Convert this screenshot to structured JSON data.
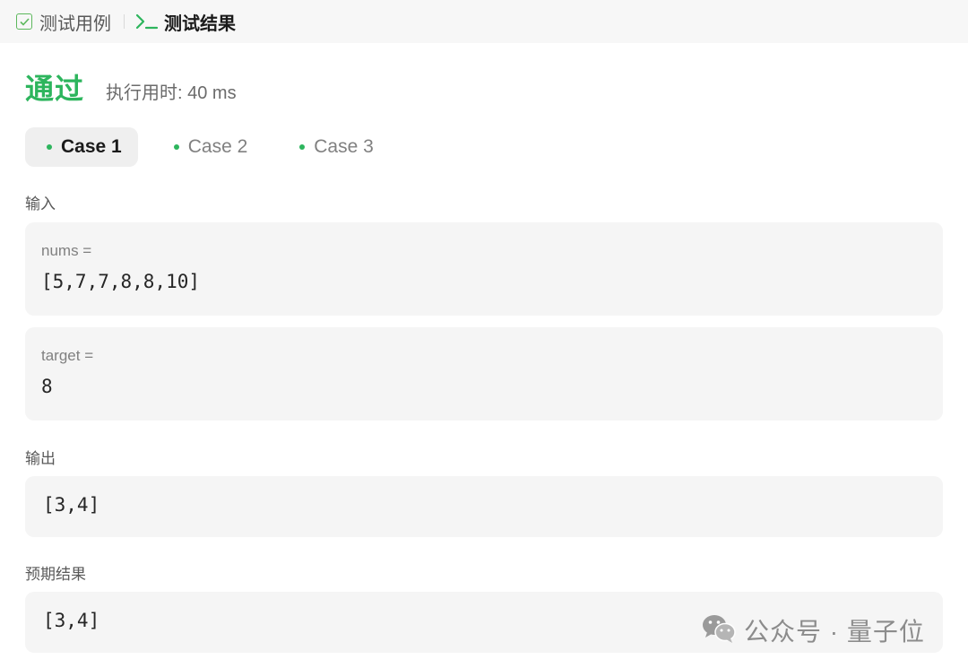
{
  "tabs": {
    "testcase_label": "测试用例",
    "result_label": "测试结果"
  },
  "result": {
    "status": "通过",
    "runtime": "执行用时: 40 ms"
  },
  "cases": [
    {
      "label": "Case 1",
      "active": true
    },
    {
      "label": "Case 2",
      "active": false
    },
    {
      "label": "Case 3",
      "active": false
    }
  ],
  "input": {
    "label": "输入",
    "params": [
      {
        "name": "nums =",
        "value": "[5,7,7,8,8,10]"
      },
      {
        "name": "target =",
        "value": "8"
      }
    ]
  },
  "output": {
    "label": "输出",
    "value": "[3,4]"
  },
  "expected": {
    "label": "预期结果",
    "value": "[3,4]"
  },
  "watermark": {
    "text": "公众号 · 量子位",
    "icon": "wechat-icon"
  },
  "colors": {
    "accent_green": "#2db55d",
    "topbar_bg": "#f7f7f7",
    "box_bg": "#f5f5f5"
  }
}
